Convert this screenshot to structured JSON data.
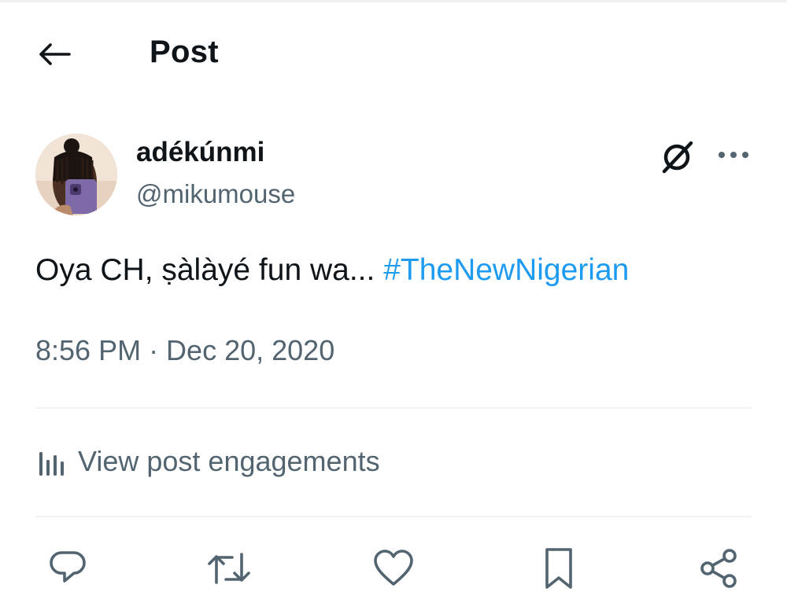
{
  "header": {
    "title": "Post",
    "back_icon": "arrow-left-icon"
  },
  "post": {
    "author": {
      "display_name": "adékúnmi",
      "handle": "@mikumouse"
    },
    "text": "Oya CH, ṣàlàyé fun wa... ",
    "hashtag": "#TheNewNigerian",
    "timestamp": "8:56 PM · Dec 20, 2020",
    "engagements_label": "View post engagements"
  },
  "icons": {
    "grok": "grok-icon",
    "more": "more-options-icon",
    "analytics": "bar-chart-icon",
    "actions": [
      "reply-icon",
      "repost-icon",
      "like-icon",
      "bookmark-icon",
      "share-icon"
    ]
  },
  "colors": {
    "text": "#0f1419",
    "secondary": "#536471",
    "link": "#1d9bf0",
    "divider": "#eff3f4"
  }
}
